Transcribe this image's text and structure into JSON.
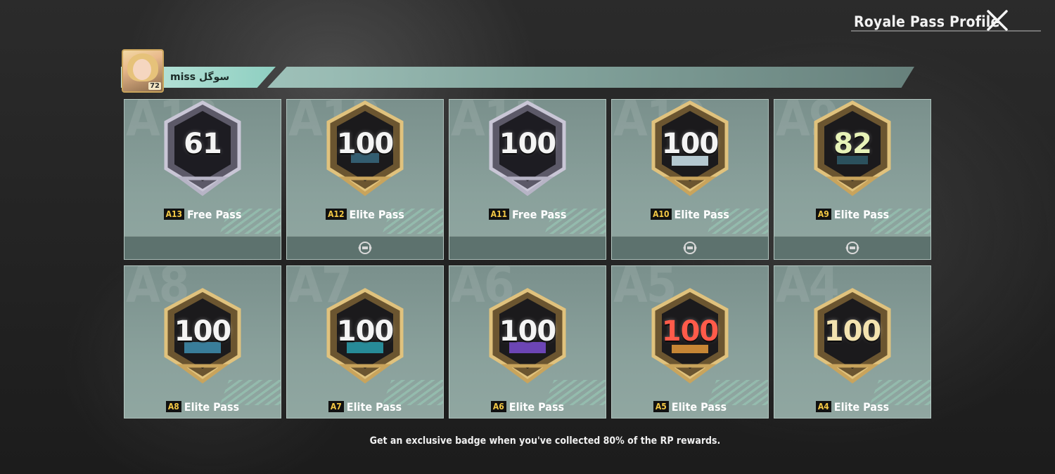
{
  "header": {
    "title": "Royale Pass Profile",
    "close_icon": "close-icon"
  },
  "profile": {
    "name": "miss سوگل",
    "level": "72",
    "avatar_icon": "avatar"
  },
  "passes": [
    {
      "season": "A13",
      "pass_type": "Free Pass",
      "badge_level": "61",
      "emblem": false
    },
    {
      "season": "A12",
      "pass_type": "Elite Pass",
      "badge_level": "100",
      "emblem": true
    },
    {
      "season": "A11",
      "pass_type": "Free Pass",
      "badge_level": "100",
      "emblem": false
    },
    {
      "season": "A10",
      "pass_type": "Elite Pass",
      "badge_level": "100",
      "emblem": true
    },
    {
      "season": "A9",
      "pass_type": "Elite Pass",
      "badge_level": "82",
      "emblem": true
    },
    {
      "season": "A8",
      "pass_type": "Elite Pass",
      "badge_level": "100"
    },
    {
      "season": "A7",
      "pass_type": "Elite Pass",
      "badge_level": "100"
    },
    {
      "season": "A6",
      "pass_type": "Elite Pass",
      "badge_level": "100"
    },
    {
      "season": "A5",
      "pass_type": "Elite Pass",
      "badge_level": "100"
    },
    {
      "season": "A4",
      "pass_type": "Elite Pass",
      "badge_level": "100"
    }
  ],
  "footer": {
    "note": "Get an exclusive badge when you've collected 80% of the RP rewards."
  },
  "colors": {
    "gold": "#c9a45c",
    "silver": "#b7b4c6",
    "accent_teal": "#8ecfc1",
    "tag_gold": "#f2c744"
  }
}
